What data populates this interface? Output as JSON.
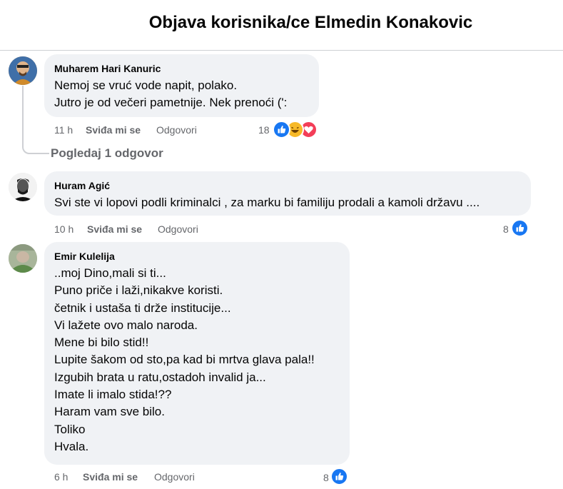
{
  "header": {
    "title": "Objava korisnika/ce Elmedin Konakovic"
  },
  "comments": [
    {
      "author": "Muharem Hari Kanuric",
      "lines": [
        "Nemoj se vruć vode napit, polako.",
        "Jutro je od večeri pametnije. Nek prenoći (':"
      ],
      "time": "11 h",
      "like_label": "Sviđa mi se",
      "reply_label": "Odgovori",
      "reaction_count": "18",
      "reactions": [
        "like-icon",
        "haha-icon",
        "love-icon"
      ]
    },
    {
      "author": "Huram Agić",
      "lines": [
        "Svi ste vi lopovi podli kriminalci , za marku bi familiju prodali a kamoli državu ...."
      ],
      "time": "10 h",
      "like_label": "Sviđa mi se",
      "reply_label": "Odgovori",
      "reaction_count": "8",
      "reactions": [
        "like-icon"
      ]
    },
    {
      "author": "Emir Kulelija",
      "lines": [
        "..moj Dino,mali si ti...",
        "Puno priče i laži,nikakve koristi.",
        "četnik i ustaša ti drže institucije...",
        "Vi lažete ovo malo naroda.",
        "Mene bi bilo stid!!",
        "Lupite šakom od sto,pa kad bi mrtva glava pala!!",
        "Izgubih brata u ratu,ostadoh invalid ja...",
        "Imate li imalo stida!??",
        "Haram vam sve bilo.",
        "Toliko",
        "Hvala."
      ],
      "time": "6 h",
      "like_label": "Sviđa mi se",
      "reply_label": "Odgovori",
      "reaction_count": "8",
      "reactions": [
        "like-icon"
      ]
    }
  ],
  "view_replies_label": "Pogledaj 1 odgovor",
  "colors": {
    "like": "#1877f2",
    "haha": "#f7b928",
    "love": "#f33e58",
    "bubble": "#f0f2f5",
    "secondary_text": "#65676b"
  }
}
